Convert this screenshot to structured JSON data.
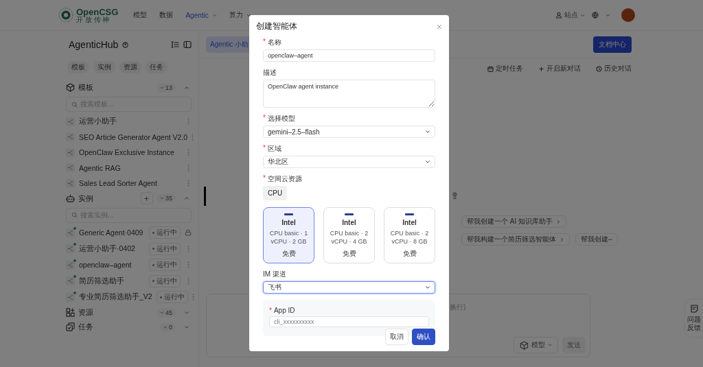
{
  "nav": {
    "logo_name": "OpenCSG",
    "logo_tagline": "开 放 传 神",
    "items": [
      {
        "label": "模型",
        "selected": false,
        "dropdown": false
      },
      {
        "label": "数据",
        "selected": false,
        "dropdown": false
      },
      {
        "label": "Agentic",
        "selected": true,
        "dropdown": true
      },
      {
        "label": "算力",
        "selected": false,
        "dropdown": true
      }
    ],
    "site_label": "站点"
  },
  "sidebar": {
    "title": "AgenticHub",
    "tabs": [
      "模板",
      "实例",
      "资源",
      "任务"
    ],
    "sections": [
      {
        "kind": "templates",
        "title": "模板",
        "count": "13",
        "expanded": true,
        "add": false,
        "search_placeholder": "搜索模板...",
        "items": [
          {
            "name": "运营小助手"
          },
          {
            "name": "SEO Article Generator Agent V2.0"
          },
          {
            "name": "OpenClaw Exclusive Instance"
          },
          {
            "name": "Agentic RAG"
          },
          {
            "name": "Sales Lead Sorter Agent"
          }
        ]
      },
      {
        "kind": "instances",
        "title": "实例",
        "count": "35",
        "expanded": true,
        "add": true,
        "search_placeholder": "搜索实例...",
        "items": [
          {
            "name": "Generic Agent·0409",
            "status": "运行中",
            "locked": true
          },
          {
            "name": "运营小助手·0402",
            "status": "运行中",
            "locked": false
          },
          {
            "name": "openclaw–agent",
            "status": "运行中",
            "locked": false
          },
          {
            "name": "简历筛选助手",
            "status": "运行中",
            "locked": false
          },
          {
            "name": "专业简历筛选助手_V2",
            "status": "运行中",
            "locked": false
          }
        ]
      },
      {
        "kind": "resources",
        "title": "资源",
        "count": "45",
        "expanded": false,
        "add": false
      },
      {
        "kind": "tasks",
        "title": "任务",
        "count": "0",
        "expanded": false,
        "add": false
      }
    ]
  },
  "main": {
    "assistant_tab": "Agentic 小助",
    "docs_button": "文档中心",
    "actions": [
      {
        "kind": "schedule",
        "label": "定时任务"
      },
      {
        "kind": "new",
        "label": "开启新对话"
      },
      {
        "kind": "history",
        "label": "历史对话"
      }
    ],
    "suggestion_rows": [
      [
        {
          "label": "帮我创建一个 AI 知识库助手",
          "arrow": true
        }
      ],
      [
        {
          "label": "帮我构建一个简历筛选智能体",
          "arrow": true
        },
        {
          "label": "帮我创建–",
          "arrow": false
        }
      ]
    ],
    "composer": {
      "placeholder": "换行)",
      "model_button": "模型",
      "send_button": "发送"
    },
    "feedback": "问题反馈"
  },
  "dialog": {
    "title": "创建智能体",
    "fields": [
      {
        "kind": "input",
        "label": "名称",
        "required_mark": "*",
        "value": "openclaw–agent"
      },
      {
        "kind": "textarea",
        "label": "描述",
        "value": "OpenClaw agent instance"
      },
      {
        "kind": "select",
        "label": "选择模型",
        "required_mark": "*",
        "value": "gemini–2.5–flash",
        "focused": false
      },
      {
        "kind": "select",
        "label": "区域",
        "required_mark": "*",
        "value": "华北区",
        "focused": false
      },
      {
        "kind": "resource",
        "label": "空间云资源",
        "required_mark": "*",
        "tabs": [
          {
            "label": "CPU",
            "selected": true
          }
        ],
        "cards": [
          {
            "title": "Intel",
            "spec": "CPU basic · 1 vCPU · 2 GB",
            "price": "免费",
            "selected": true
          },
          {
            "title": "Intel",
            "spec": "CPU basic · 2 vCPU · 4 GB",
            "price": "免费",
            "selected": false
          },
          {
            "title": "Intel",
            "spec": "CPU basic · 2 vCPU · 8 GB",
            "price": "免费",
            "selected": false
          }
        ]
      },
      {
        "kind": "select",
        "label": "IM 渠道",
        "value": "飞书",
        "focused": true,
        "panel": [
          {
            "kind": "input",
            "label": "App ID",
            "required_mark": "*",
            "placeholder": "cli_xxxxxxxxxx"
          }
        ]
      }
    ],
    "cancel_button": "取消",
    "confirm_button": "确认"
  }
}
